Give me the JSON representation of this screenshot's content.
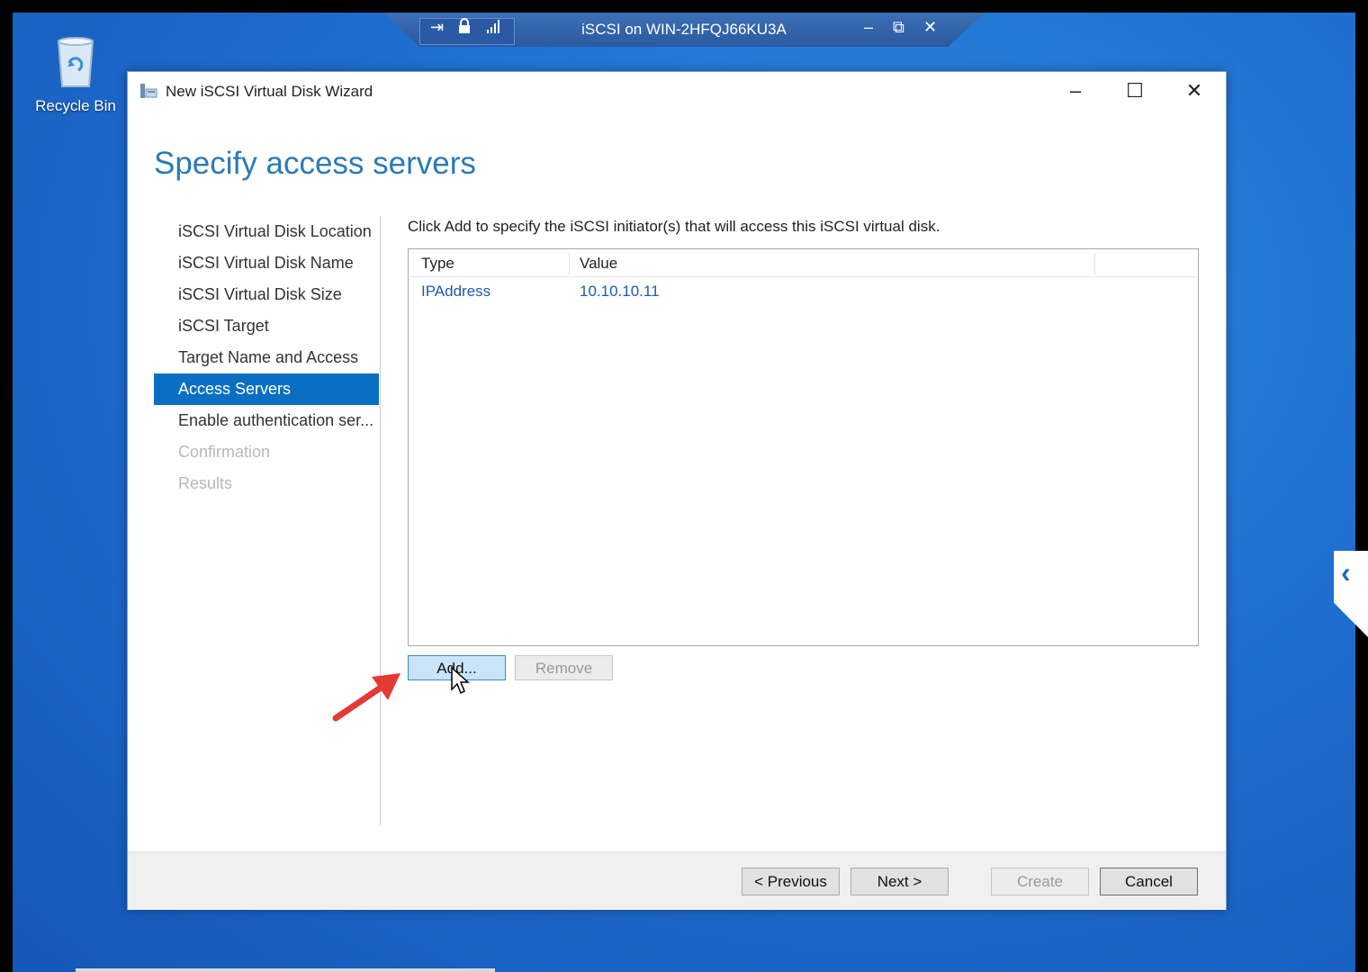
{
  "desktop": {
    "recycle_bin_label": "Recycle Bin"
  },
  "rdp_bar": {
    "title": "iSCSI on WIN-2HFQJ66KU3A",
    "icons": [
      "pin-icon",
      "lock-icon",
      "signal-icon"
    ],
    "controls": [
      "minimize-icon",
      "restore-icon",
      "close-icon"
    ]
  },
  "window": {
    "title": "New iSCSI Virtual Disk Wizard",
    "page_title": "Specify access servers",
    "steps": [
      {
        "label": "iSCSI Virtual Disk Location",
        "state": "done"
      },
      {
        "label": "iSCSI Virtual Disk Name",
        "state": "done"
      },
      {
        "label": "iSCSI Virtual Disk Size",
        "state": "done"
      },
      {
        "label": "iSCSI Target",
        "state": "done"
      },
      {
        "label": "Target Name and Access",
        "state": "done"
      },
      {
        "label": "Access Servers",
        "state": "active"
      },
      {
        "label": "Enable authentication ser...",
        "state": "normal"
      },
      {
        "label": "Confirmation",
        "state": "disabled"
      },
      {
        "label": "Results",
        "state": "disabled"
      }
    ],
    "instruction": "Click Add to specify the iSCSI initiator(s) that will access this iSCSI virtual disk.",
    "table": {
      "columns": [
        "Type",
        "Value"
      ],
      "rows": [
        {
          "type": "IPAddress",
          "value": "10.10.10.11"
        }
      ]
    },
    "buttons": {
      "add": "Add...",
      "remove": "Remove",
      "previous": "< Previous",
      "next": "Next >",
      "create": "Create",
      "cancel": "Cancel"
    }
  },
  "colors": {
    "accent": "#0a6fc2",
    "title_blue": "#2b7bb5",
    "desktop": "#1f6fd0",
    "annotation_arrow": "#e53935"
  }
}
